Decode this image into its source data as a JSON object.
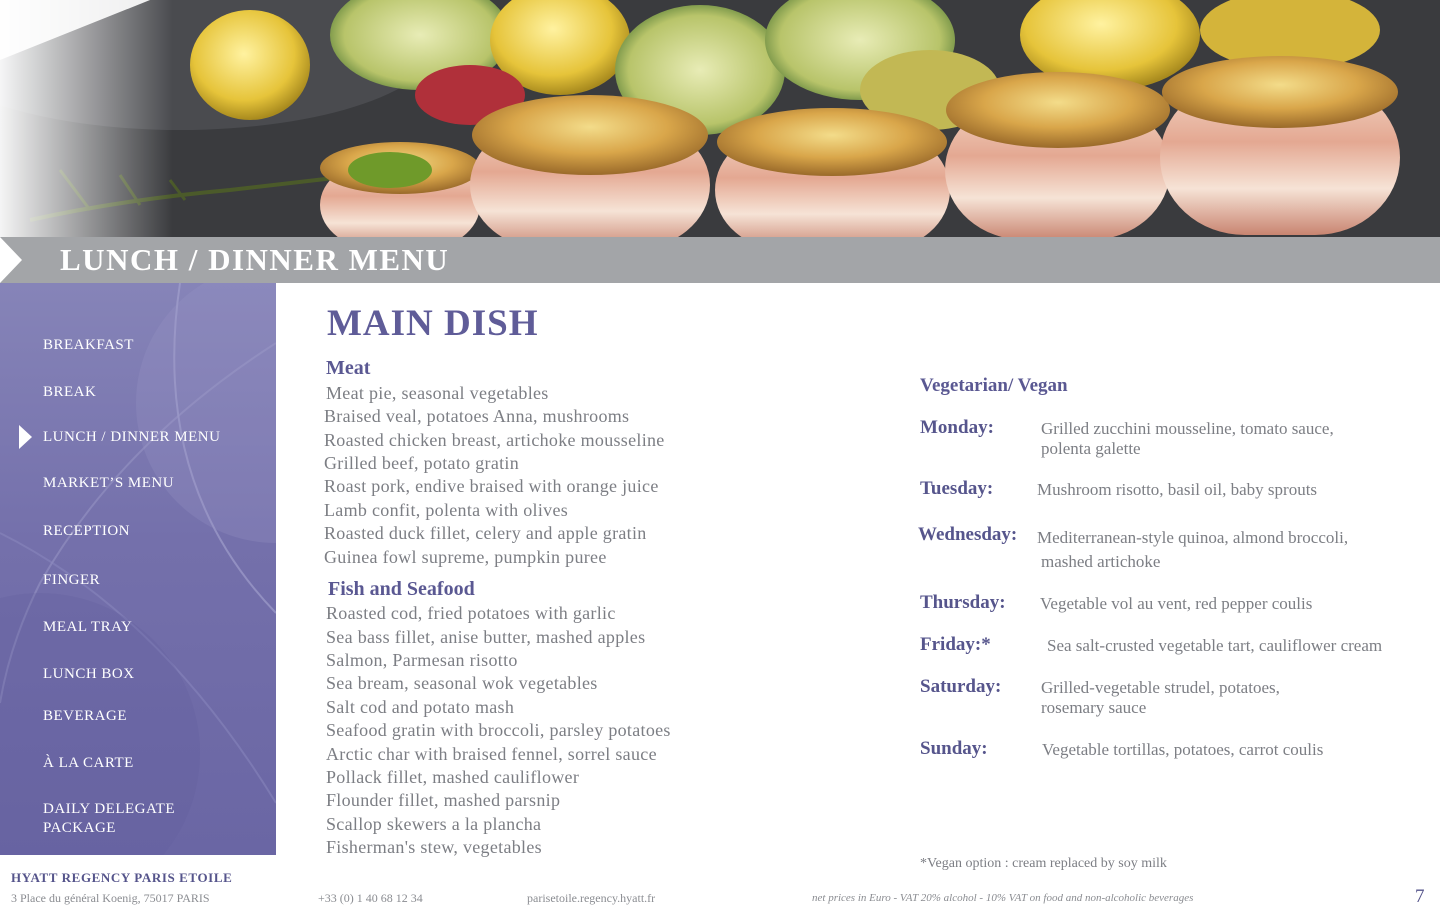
{
  "header": {
    "title": "LUNCH / DINNER MENU"
  },
  "sidebar": {
    "items": [
      {
        "label": "BREAKFAST"
      },
      {
        "label": "BREAK"
      },
      {
        "label": "LUNCH / DINNER MENU"
      },
      {
        "label": "MARKET’S MENU"
      },
      {
        "label": "RECEPTION"
      },
      {
        "label": "FINGER"
      },
      {
        "label": "MEAL TRAY"
      },
      {
        "label": "LUNCH BOX"
      },
      {
        "label": "BEVERAGE"
      },
      {
        "label": "À LA CARTE"
      },
      {
        "label": "DAILY DELEGATE",
        "label2": "PACKAGE"
      }
    ],
    "active": "LUNCH / DINNER MENU"
  },
  "main": {
    "title": "MAIN DISH",
    "meat": {
      "heading": "Meat",
      "items": [
        "Meat pie, seasonal vegetables",
        "Braised veal, potatoes Anna, mushrooms",
        "Roasted chicken breast, artichoke mousseline",
        "Grilled beef, potato gratin",
        "Roast pork, endive braised with orange juice",
        "Lamb confit, polenta with olives",
        "Roasted duck fillet, celery and apple gratin",
        "Guinea fowl supreme, pumpkin puree"
      ]
    },
    "fish": {
      "heading": "Fish and Seafood",
      "items": [
        "Roasted cod, fried potatoes with garlic",
        "Sea bass fillet, anise butter, mashed apples",
        "Salmon, Parmesan risotto",
        "Sea bream, seasonal wok vegetables",
        "Salt cod and potato mash",
        "Seafood gratin with broccoli, parsley potatoes",
        "Arctic char with braised fennel, sorrel sauce",
        "Pollack fillet, mashed cauliflower",
        "Flounder fillet, mashed parsnip",
        "Scallop skewers a la plancha",
        "Fisherman's stew, vegetables"
      ]
    },
    "vegetarian": {
      "heading": "Vegetarian/ Vegan",
      "days": [
        {
          "day": "Monday:",
          "line1": "Grilled zucchini mousseline, tomato sauce,",
          "line2": "polenta galette"
        },
        {
          "day": "Tuesday:",
          "line1": "Mushroom risotto, basil oil, baby sprouts",
          "line2": ""
        },
        {
          "day": "Wednesday:",
          "line1": "Mediterranean-style quinoa, almond broccoli,",
          "line2": "mashed artichoke"
        },
        {
          "day": "Thursday:",
          "line1": "Vegetable vol au vent, red pepper coulis",
          "line2": ""
        },
        {
          "day": "Friday:*",
          "line1": "Sea salt-crusted vegetable tart, cauliflower cream",
          "line2": ""
        },
        {
          "day": "Saturday:",
          "line1": "Grilled-vegetable strudel, potatoes,",
          "line2": "rosemary sauce"
        },
        {
          "day": "Sunday:",
          "line1": "Vegetable tortillas, potatoes, carrot coulis",
          "line2": ""
        }
      ],
      "footnote": "*Vegan option : cream replaced by soy milk"
    }
  },
  "footer": {
    "brand": "HYATT REGENCY PARIS ETOILE",
    "address": "3 Place du général Koenig,  75017 PARIS",
    "phone": "+33 (0) 1 40 68 12 34",
    "website": "parisetoile.regency.hyatt.fr",
    "note": "net prices in Euro - VAT 20% alcohol - 10% VAT on food and non-alcoholic beverages",
    "page": "7"
  },
  "colors": {
    "accent": "#5f5c98",
    "sidebar": "#7470ab",
    "band": "#a3a5a8",
    "body_text": "#7c7e84"
  }
}
